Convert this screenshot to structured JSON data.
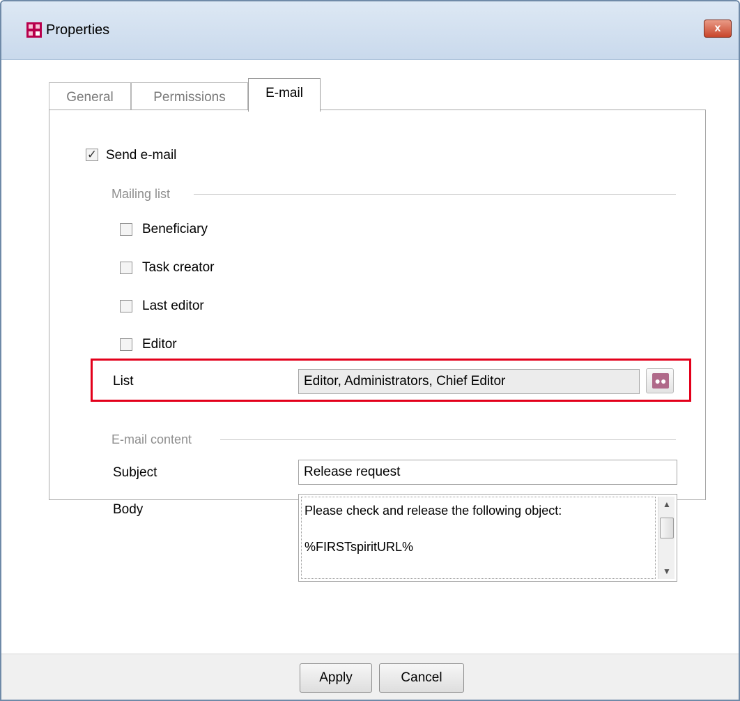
{
  "window": {
    "title": "Properties",
    "close_glyph": "x"
  },
  "tabs": [
    {
      "label": "General",
      "active": false
    },
    {
      "label": "Permissions",
      "active": false
    },
    {
      "label": "E-mail",
      "active": true
    }
  ],
  "send_email": {
    "label": "Send e-mail",
    "checked": true,
    "check_glyph": "✓"
  },
  "mailing_list": {
    "group_label": "Mailing list",
    "items": [
      {
        "label": "Beneficiary",
        "checked": false
      },
      {
        "label": "Task creator",
        "checked": false
      },
      {
        "label": "Last editor",
        "checked": false
      },
      {
        "label": "Editor",
        "checked": false
      }
    ],
    "list_label": "List",
    "list_value": "Editor, Administrators, Chief Editor",
    "list_button_icon": "user-group-icon"
  },
  "email_content": {
    "group_label": "E-mail content",
    "subject_label": "Subject",
    "subject_value": "Release request",
    "body_label": "Body",
    "body_value": "Please check and release the following object:\n\n%FIRSTspiritURL%"
  },
  "buttons": {
    "apply": "Apply",
    "cancel": "Cancel"
  },
  "colors": {
    "highlight": "#e3001b",
    "titlebar": "#c9d9ec",
    "app_icon": "#b8004c"
  }
}
